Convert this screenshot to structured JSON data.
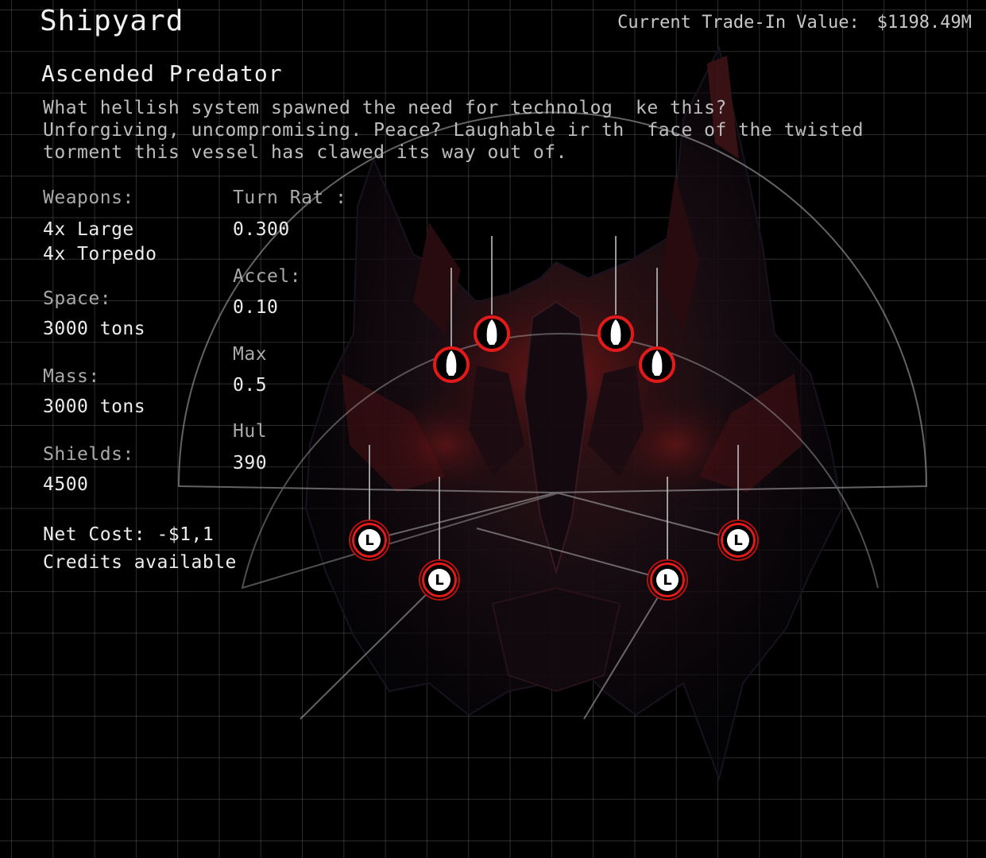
{
  "header": {
    "title": "Shipyard",
    "trade_in_label": "Current Trade-In Value:",
    "trade_in_value": "$1198.49M"
  },
  "ship": {
    "name": "Ascended Predator",
    "description": "What hellish system spawned the need for technolog  ke this?\nUnforgiving, uncompromising. Peace? Laughable ir th  face of the twisted\ntorment this vessel has clawed its way out of."
  },
  "stats": {
    "weapons_label": "Weapons:",
    "weapons_values": [
      "4x Large",
      "4x Torpedo"
    ],
    "space_label": "Space:",
    "space_value": "3000 tons",
    "mass_label": "Mass:",
    "mass_value": "3000 tons",
    "shields_label": "Shields:",
    "shields_value": "4500",
    "turn_rate_label": "Turn Rat :",
    "turn_rate_value": "0.300",
    "accel_label": "Accel:",
    "accel_value": "0.10",
    "max_label": "Max",
    "max_value": "0.5",
    "hull_label": "Hul",
    "hull_value": "390"
  },
  "footer": {
    "net_cost": "Net Cost: -$1,1",
    "credits": "Credits available"
  },
  "hardpoints": {
    "torpedo_glyph": "rocket-icon",
    "large_glyph": "L",
    "colors": {
      "ring": "#e21a1a",
      "arc": "#b4b4b4",
      "hull_red": "#7a0d0d"
    }
  }
}
